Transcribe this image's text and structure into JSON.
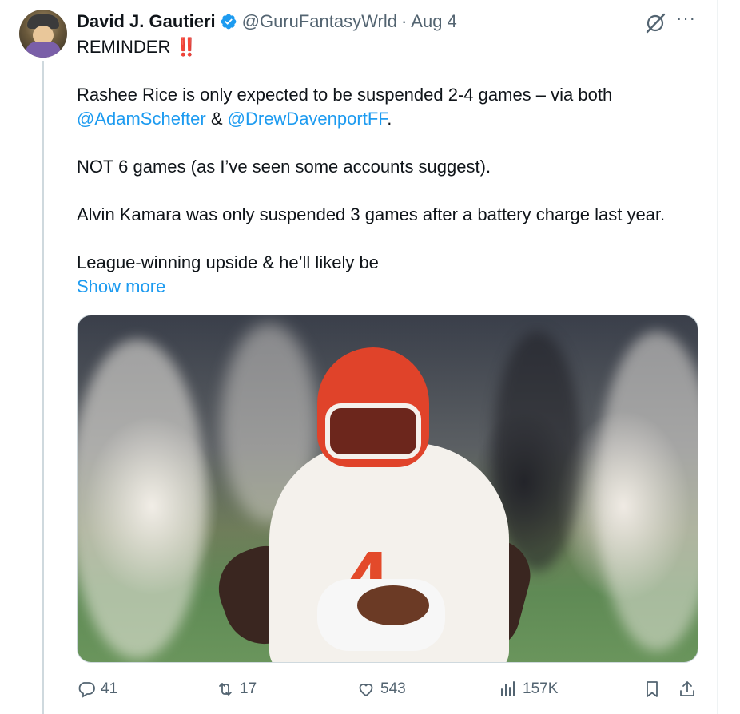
{
  "tweet": {
    "author_name": "David J. Gautieri",
    "handle": "@GuruFantasyWrld",
    "separator": "·",
    "date": "Aug 4",
    "more_label": "···",
    "text": {
      "line1": "REMINDER",
      "line1_emoji": "‼️",
      "p2_before": "Rashee Rice is only expected to be suspended 2-4 games – via both",
      "mention1": "@AdamSchefter",
      "amp": " & ",
      "mention2": "@DrewDavenportFF",
      "period": ".",
      "p3": "NOT 6 games (as I’ve seen some accounts suggest).",
      "p4": "Alvin Kamara was only suspended 3 games after a battery charge last year.",
      "p5": "League-winning upside & he’ll likely be"
    },
    "show_more": "Show more",
    "stats": {
      "replies": "41",
      "retweets": "17",
      "likes": "543",
      "views": "157K"
    }
  },
  "icons": {
    "verified": "verified-badge-icon",
    "grok": "grok-icon",
    "reply": "reply-icon",
    "retweet": "retweet-icon",
    "like": "heart-icon",
    "views": "views-chart-icon",
    "bookmark": "bookmark-icon",
    "share": "share-icon"
  },
  "colors": {
    "link": "#1d9bf0",
    "muted": "#536471",
    "text": "#0f1419",
    "verified": "#1d9bf0"
  }
}
